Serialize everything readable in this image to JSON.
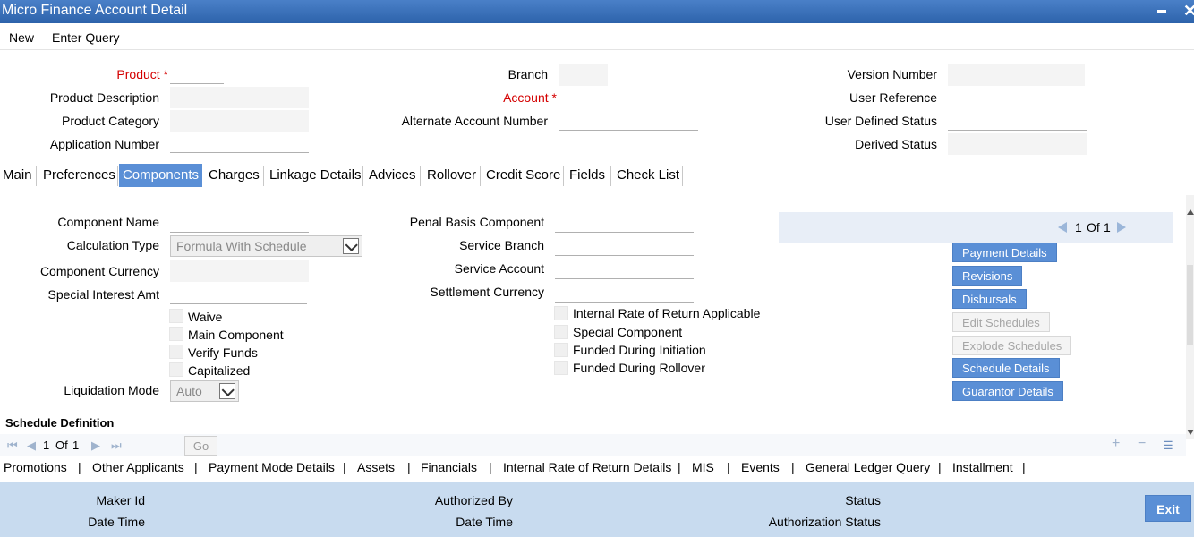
{
  "window": {
    "title": "Micro Finance Account Detail"
  },
  "menu": {
    "new": "New",
    "enter_query": "Enter Query"
  },
  "header": {
    "product_label": "Product",
    "product_desc_label": "Product Description",
    "product_category_label": "Product Category",
    "application_number_label": "Application Number",
    "branch_label": "Branch",
    "account_label": "Account",
    "alternate_account_label": "Alternate Account Number",
    "version_number_label": "Version Number",
    "user_reference_label": "User Reference",
    "user_defined_status_label": "User Defined Status",
    "derived_status_label": "Derived Status",
    "required_mark": "*"
  },
  "tabs": [
    "Main",
    "Preferences",
    "Components",
    "Charges",
    "Linkage Details",
    "Advices",
    "Rollover",
    "Credit Score",
    "Fields",
    "Check List"
  ],
  "components": {
    "component_name_label": "Component Name",
    "calculation_type_label": "Calculation Type",
    "calculation_type_value": "Formula With Schedule",
    "component_currency_label": "Component Currency",
    "special_interest_amt_label": "Special Interest Amt",
    "checkboxes_left": [
      "Waive",
      "Main Component",
      "Verify Funds",
      "Capitalized"
    ],
    "liquidation_mode_label": "Liquidation Mode",
    "liquidation_mode_value": "Auto",
    "penal_basis_label": "Penal Basis Component",
    "service_branch_label": "Service Branch",
    "service_account_label": "Service Account",
    "settlement_currency_label": "Settlement Currency",
    "checkboxes_right": [
      "Internal Rate of Return Applicable",
      "Special Component",
      "Funded During Initiation",
      "Funded During Rollover"
    ]
  },
  "pager": {
    "current": "1",
    "of_label": "Of",
    "total": "1"
  },
  "buttons": {
    "payment_details": "Payment Details",
    "revisions": "Revisions",
    "disbursals": "Disbursals",
    "edit_schedules": "Edit Schedules",
    "explode_schedules": "Explode Schedules",
    "schedule_details": "Schedule Details",
    "guarantor_details": "Guarantor Details"
  },
  "schedule": {
    "title": "Schedule Definition",
    "page_current": "1",
    "of_label": "Of",
    "page_total": "1",
    "go_label": "Go"
  },
  "links": [
    "Promotions",
    "Other Applicants",
    "Payment Mode Details",
    "Assets",
    "Financials",
    "Internal Rate of Return Details",
    "MIS",
    "Events",
    "General Ledger Query",
    "Installment"
  ],
  "link_separator": "|",
  "footer": {
    "maker_id_label": "Maker Id",
    "date_time_label": "Date Time",
    "authorized_by_label": "Authorized By",
    "checker_date_time_label": "Date Time",
    "status_label": "Status",
    "authorization_status_label": "Authorization Status",
    "exit_label": "Exit"
  },
  "colors": {
    "accent": "#5a8fd6",
    "titlebar": "#2d63ab",
    "footer": "#c8dbef",
    "required": "#d40000"
  }
}
